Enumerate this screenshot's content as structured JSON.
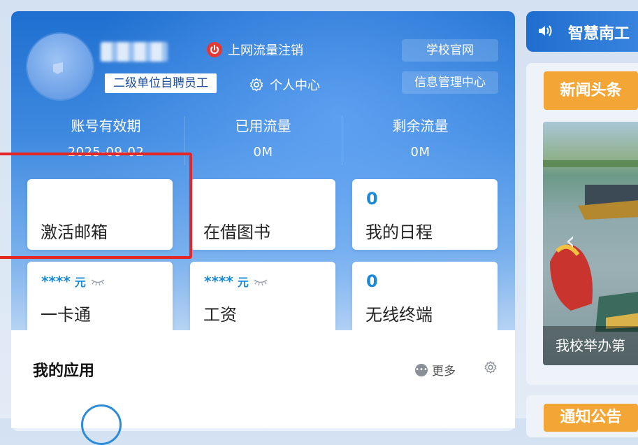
{
  "profile": {
    "role_badge": "二级单位自聘员工",
    "logout_label": "上网流量注销",
    "profile_center_label": "个人中心",
    "school_site_label": "学校官网",
    "info_center_label": "信息管理中心"
  },
  "stats": [
    {
      "label": "账号有效期",
      "value": "2025-09-02"
    },
    {
      "label": "已用流量",
      "value": "0M"
    },
    {
      "label": "剩余流量",
      "value": "0M"
    }
  ],
  "cards": [
    {
      "title": "激活邮箱",
      "value": ""
    },
    {
      "title": "在借图书",
      "value": ""
    },
    {
      "title": "我的日程",
      "value": "0"
    },
    {
      "title": "一卡通",
      "value": "****",
      "unit": "元"
    },
    {
      "title": "工资",
      "value": "****",
      "unit": "元"
    },
    {
      "title": "无线终端",
      "value": "0"
    }
  ],
  "apps": {
    "title": "我的应用",
    "more_label": "更多"
  },
  "right": {
    "banner_title": "智慧南工",
    "news_tab": "新闻头条",
    "news_caption": "我校举办第",
    "notice_tab": "通知公告"
  },
  "colors": {
    "accent": "#1a8ad8",
    "highlight": "#e62525",
    "tab_orange": "#f3a636"
  }
}
